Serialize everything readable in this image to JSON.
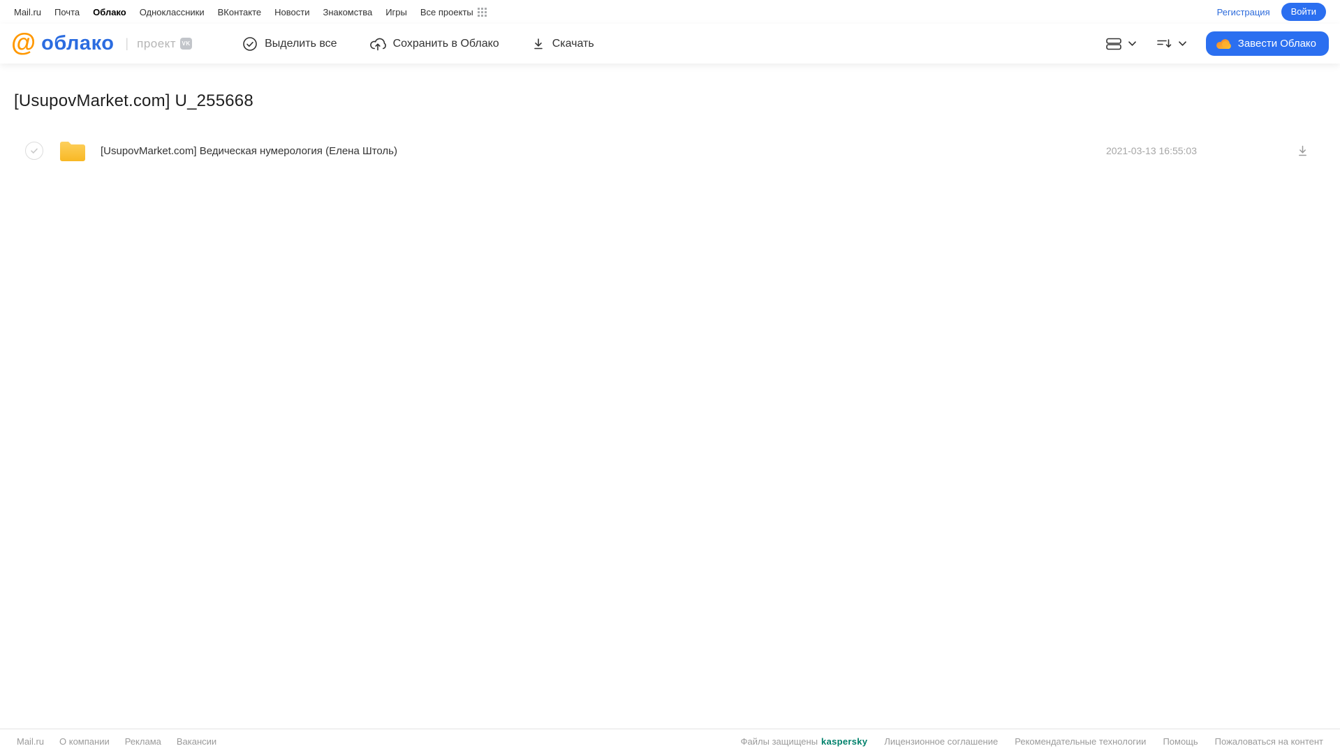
{
  "topbar": {
    "links": [
      {
        "label": "Mail.ru"
      },
      {
        "label": "Почта"
      },
      {
        "label": "Облако"
      },
      {
        "label": "Одноклассники"
      },
      {
        "label": "ВКонтакте"
      },
      {
        "label": "Новости"
      },
      {
        "label": "Знакомства"
      },
      {
        "label": "Игры"
      },
      {
        "label": "Все проекты"
      }
    ],
    "register_label": "Регистрация",
    "login_label": "Войти"
  },
  "header": {
    "logo_at": "@",
    "logo_text": "облако",
    "separator": "|",
    "project_label": "проект",
    "vk_badge": "VK",
    "toolbar": {
      "select_all_label": "Выделить все",
      "save_to_cloud_label": "Сохранить в Облако",
      "download_label": "Скачать"
    },
    "cta_label": "Завести Облако"
  },
  "main": {
    "title": "[UsupovMarket.com] U_255668",
    "files": [
      {
        "name": "[UsupovMarket.com] Ведическая нумерология (Елена Штоль)",
        "date": "2021-03-13 16:55:03",
        "type": "folder"
      }
    ]
  },
  "footer": {
    "left_links": [
      "Mail.ru",
      "О компании",
      "Реклама",
      "Вакансии"
    ],
    "protected_text": "Файлы защищены",
    "kaspersky_label": "kaspersky",
    "right_links": [
      "Лицензионное соглашение",
      "Рекомендательные технологии",
      "Помощь",
      "Пожаловаться на контент"
    ]
  },
  "colors": {
    "accent_blue": "#2b6ff0",
    "link_blue": "#2d6bdb",
    "logo_orange": "#ff9800",
    "logo_blue": "#2b6ce0",
    "folder_yellow": "#fbc43a",
    "kaspersky_green": "#00816b"
  }
}
